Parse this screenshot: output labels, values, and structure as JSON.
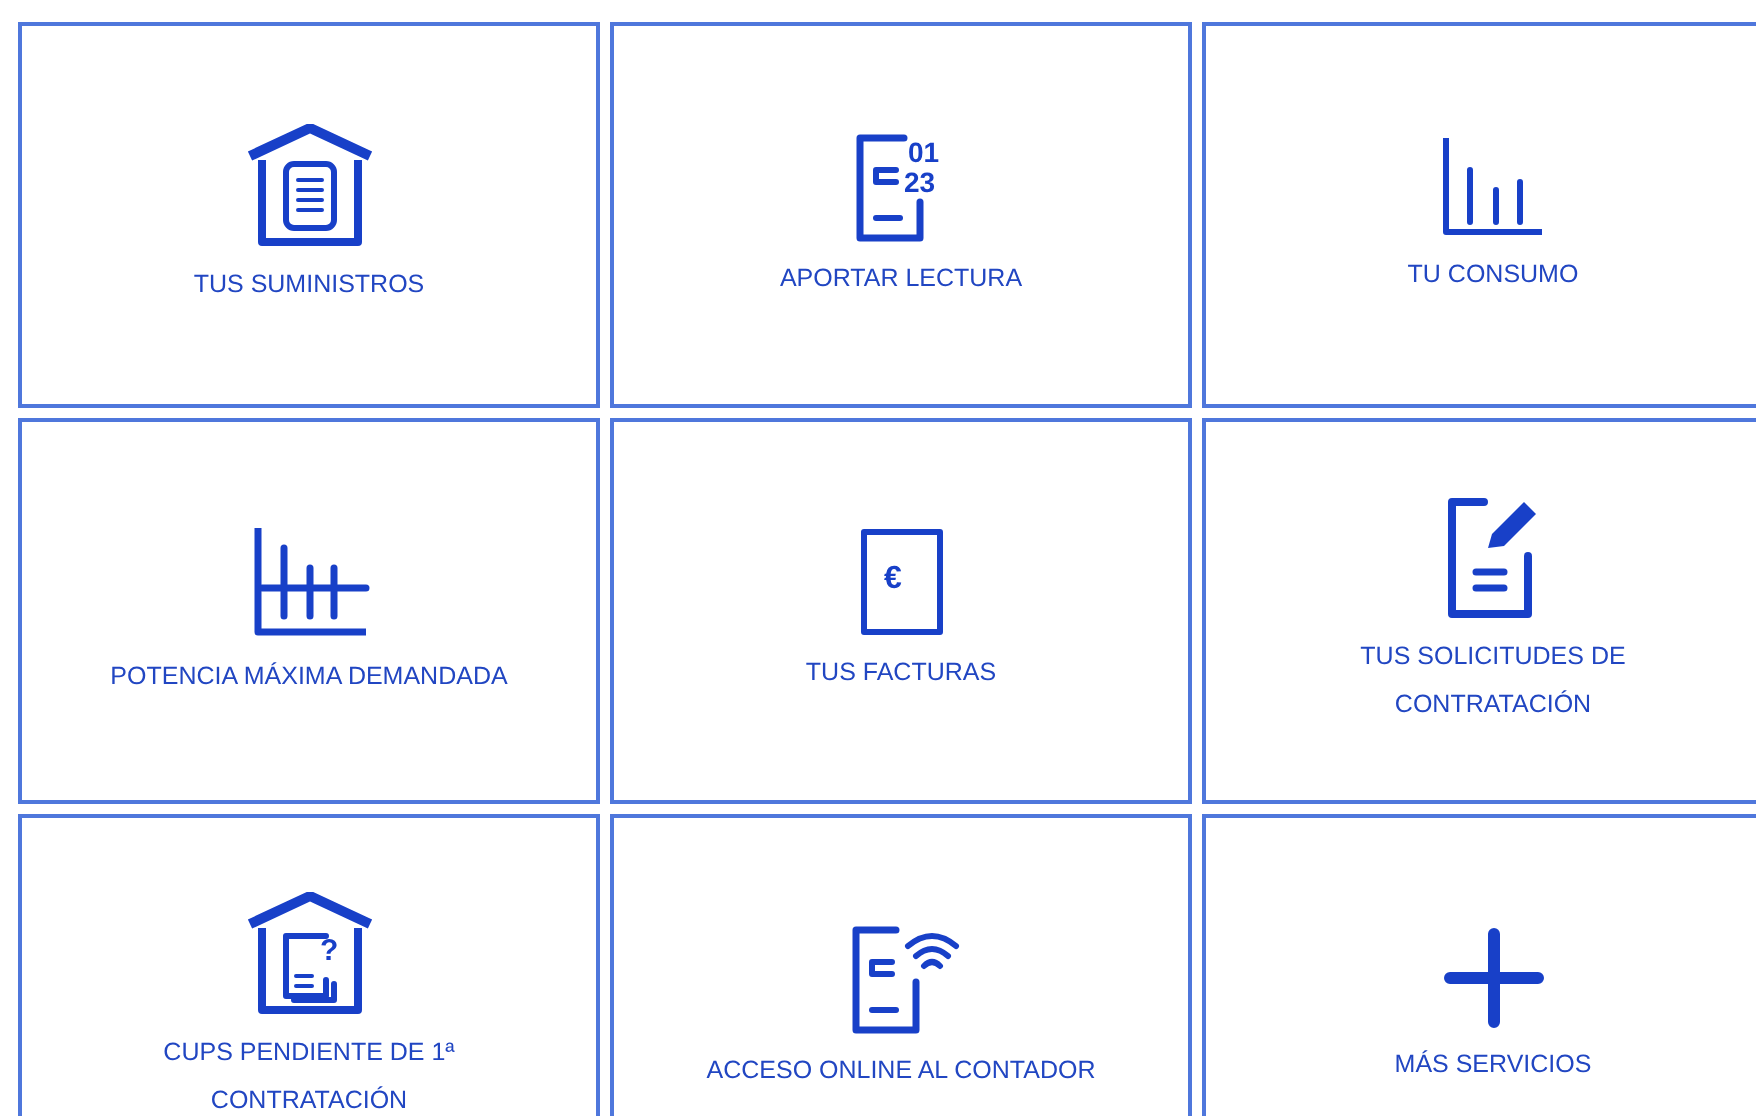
{
  "tiles": [
    {
      "label": "TUS SUMINISTROS",
      "kind": "house-document"
    },
    {
      "label": "APORTAR LECTURA",
      "kind": "meter-digits",
      "icon_text": [
        "01",
        "23"
      ]
    },
    {
      "label": "TU CONSUMO",
      "kind": "bar-chart"
    },
    {
      "label": "POTENCIA MÁXIMA DEMANDADA",
      "kind": "power-chart"
    },
    {
      "label": "TUS FACTURAS",
      "kind": "invoice",
      "icon_text": [
        "€"
      ]
    },
    {
      "label": "TUS SOLICITUDES DE CONTRATACIÓN",
      "kind": "document-edit"
    },
    {
      "label": "CUPS PENDIENTE DE 1ª CONTRATACIÓN",
      "kind": "house-question",
      "icon_text": [
        "?"
      ]
    },
    {
      "label": "ACCESO ONLINE AL CONTADOR",
      "kind": "meter-wifi"
    },
    {
      "label": "MÁS SERVICIOS",
      "kind": "plus"
    }
  ]
}
